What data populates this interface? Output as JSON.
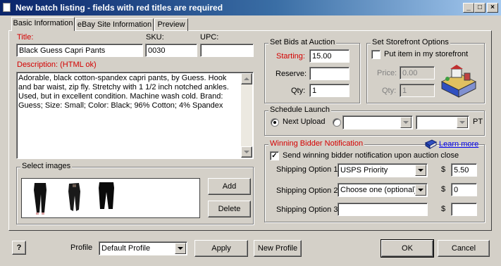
{
  "window": {
    "title": "New batch listing - fields with red titles are required"
  },
  "tabs": [
    {
      "label": "Basic Information",
      "active": true
    },
    {
      "label": "eBay Site Information",
      "active": false
    },
    {
      "label": "Preview",
      "active": false
    }
  ],
  "basic": {
    "title_label": "Title:",
    "title_value": "Black Guess Capri Pants",
    "sku_label": "SKU:",
    "sku_value": "0030",
    "upc_label": "UPC:",
    "upc_value": "",
    "description_label": "Description: (HTML ok)",
    "description_value": "Adorable, black cotton-spandex capri pants, by Guess. Hook and bar waist, zip fly. Stretchy with 1 1/2 inch notched ankles. Used, but in excellent condition. Machine wash cold. Brand: Guess; Size: Small; Color: Black; 96% Cotton; 4% Spandex"
  },
  "images": {
    "group_label": "Select images",
    "add_label": "Add",
    "delete_label": "Delete"
  },
  "bids": {
    "group_label": "Set Bids at Auction",
    "starting_label": "Starting:",
    "starting_value": "15.00",
    "reserve_label": "Reserve:",
    "reserve_value": "",
    "qty_label": "Qty:",
    "qty_value": "1"
  },
  "storefront": {
    "group_label": "Set Storefront Options",
    "checkbox_label": "Put item in my storefront",
    "checked": false,
    "price_label": "Price:",
    "price_value": "0.00",
    "qty_label": "Qty:",
    "qty_value": "1"
  },
  "schedule": {
    "group_label": "Schedule Launch",
    "next_upload_label": "Next Upload",
    "pt_label": "PT"
  },
  "winning": {
    "group_label": "Winning Bidder Notification",
    "learn_more": "Learn more",
    "send_label": "Send winning bidder notification upon auction close",
    "send_checked": true,
    "ship1_label": "Shipping Option 1:",
    "ship1_value": "USPS Priority",
    "ship1_cost": "5.50",
    "ship2_label": "Shipping Option 2:",
    "ship2_value": "Choose one (optional)",
    "ship2_cost": "0",
    "ship3_label": "Shipping Option 3:",
    "ship3_value": "",
    "ship3_cost": "",
    "currency": "$"
  },
  "footer": {
    "help_label": "?",
    "profile_label": "Profile",
    "profile_value": "Default Profile",
    "apply_label": "Apply",
    "new_profile_label": "New Profile",
    "ok_label": "OK",
    "cancel_label": "Cancel"
  },
  "icons": {
    "window_icon": "document-icon",
    "help_icon": "help-icon",
    "learn_more_icon": "book-icon",
    "storefront_icon": "storefront-icon"
  }
}
